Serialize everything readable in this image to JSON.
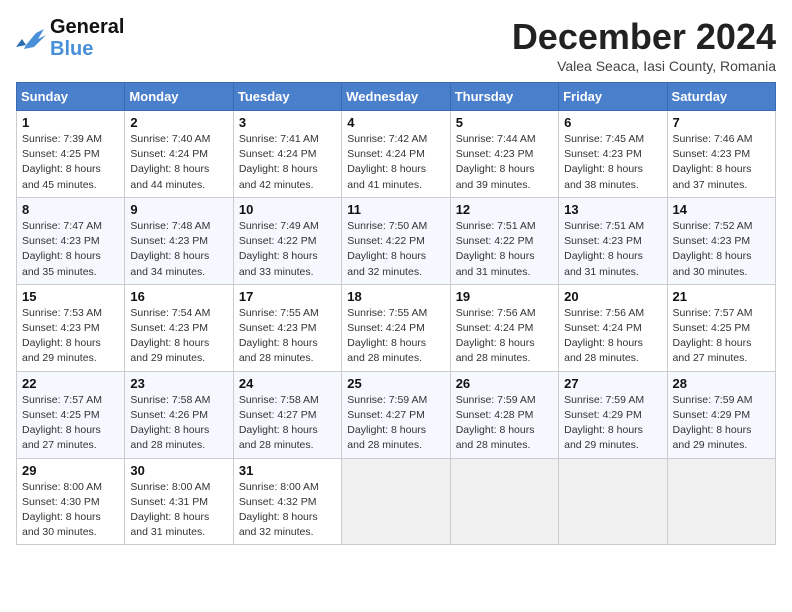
{
  "header": {
    "logo_line1": "General",
    "logo_line2": "Blue",
    "month_title": "December 2024",
    "location": "Valea Seaca, Iasi County, Romania"
  },
  "weekdays": [
    "Sunday",
    "Monday",
    "Tuesday",
    "Wednesday",
    "Thursday",
    "Friday",
    "Saturday"
  ],
  "weeks": [
    [
      {
        "day": "1",
        "sunrise": "Sunrise: 7:39 AM",
        "sunset": "Sunset: 4:25 PM",
        "daylight": "Daylight: 8 hours and 45 minutes."
      },
      {
        "day": "2",
        "sunrise": "Sunrise: 7:40 AM",
        "sunset": "Sunset: 4:24 PM",
        "daylight": "Daylight: 8 hours and 44 minutes."
      },
      {
        "day": "3",
        "sunrise": "Sunrise: 7:41 AM",
        "sunset": "Sunset: 4:24 PM",
        "daylight": "Daylight: 8 hours and 42 minutes."
      },
      {
        "day": "4",
        "sunrise": "Sunrise: 7:42 AM",
        "sunset": "Sunset: 4:24 PM",
        "daylight": "Daylight: 8 hours and 41 minutes."
      },
      {
        "day": "5",
        "sunrise": "Sunrise: 7:44 AM",
        "sunset": "Sunset: 4:23 PM",
        "daylight": "Daylight: 8 hours and 39 minutes."
      },
      {
        "day": "6",
        "sunrise": "Sunrise: 7:45 AM",
        "sunset": "Sunset: 4:23 PM",
        "daylight": "Daylight: 8 hours and 38 minutes."
      },
      {
        "day": "7",
        "sunrise": "Sunrise: 7:46 AM",
        "sunset": "Sunset: 4:23 PM",
        "daylight": "Daylight: 8 hours and 37 minutes."
      }
    ],
    [
      {
        "day": "8",
        "sunrise": "Sunrise: 7:47 AM",
        "sunset": "Sunset: 4:23 PM",
        "daylight": "Daylight: 8 hours and 35 minutes."
      },
      {
        "day": "9",
        "sunrise": "Sunrise: 7:48 AM",
        "sunset": "Sunset: 4:23 PM",
        "daylight": "Daylight: 8 hours and 34 minutes."
      },
      {
        "day": "10",
        "sunrise": "Sunrise: 7:49 AM",
        "sunset": "Sunset: 4:22 PM",
        "daylight": "Daylight: 8 hours and 33 minutes."
      },
      {
        "day": "11",
        "sunrise": "Sunrise: 7:50 AM",
        "sunset": "Sunset: 4:22 PM",
        "daylight": "Daylight: 8 hours and 32 minutes."
      },
      {
        "day": "12",
        "sunrise": "Sunrise: 7:51 AM",
        "sunset": "Sunset: 4:22 PM",
        "daylight": "Daylight: 8 hours and 31 minutes."
      },
      {
        "day": "13",
        "sunrise": "Sunrise: 7:51 AM",
        "sunset": "Sunset: 4:23 PM",
        "daylight": "Daylight: 8 hours and 31 minutes."
      },
      {
        "day": "14",
        "sunrise": "Sunrise: 7:52 AM",
        "sunset": "Sunset: 4:23 PM",
        "daylight": "Daylight: 8 hours and 30 minutes."
      }
    ],
    [
      {
        "day": "15",
        "sunrise": "Sunrise: 7:53 AM",
        "sunset": "Sunset: 4:23 PM",
        "daylight": "Daylight: 8 hours and 29 minutes."
      },
      {
        "day": "16",
        "sunrise": "Sunrise: 7:54 AM",
        "sunset": "Sunset: 4:23 PM",
        "daylight": "Daylight: 8 hours and 29 minutes."
      },
      {
        "day": "17",
        "sunrise": "Sunrise: 7:55 AM",
        "sunset": "Sunset: 4:23 PM",
        "daylight": "Daylight: 8 hours and 28 minutes."
      },
      {
        "day": "18",
        "sunrise": "Sunrise: 7:55 AM",
        "sunset": "Sunset: 4:24 PM",
        "daylight": "Daylight: 8 hours and 28 minutes."
      },
      {
        "day": "19",
        "sunrise": "Sunrise: 7:56 AM",
        "sunset": "Sunset: 4:24 PM",
        "daylight": "Daylight: 8 hours and 28 minutes."
      },
      {
        "day": "20",
        "sunrise": "Sunrise: 7:56 AM",
        "sunset": "Sunset: 4:24 PM",
        "daylight": "Daylight: 8 hours and 28 minutes."
      },
      {
        "day": "21",
        "sunrise": "Sunrise: 7:57 AM",
        "sunset": "Sunset: 4:25 PM",
        "daylight": "Daylight: 8 hours and 27 minutes."
      }
    ],
    [
      {
        "day": "22",
        "sunrise": "Sunrise: 7:57 AM",
        "sunset": "Sunset: 4:25 PM",
        "daylight": "Daylight: 8 hours and 27 minutes."
      },
      {
        "day": "23",
        "sunrise": "Sunrise: 7:58 AM",
        "sunset": "Sunset: 4:26 PM",
        "daylight": "Daylight: 8 hours and 28 minutes."
      },
      {
        "day": "24",
        "sunrise": "Sunrise: 7:58 AM",
        "sunset": "Sunset: 4:27 PM",
        "daylight": "Daylight: 8 hours and 28 minutes."
      },
      {
        "day": "25",
        "sunrise": "Sunrise: 7:59 AM",
        "sunset": "Sunset: 4:27 PM",
        "daylight": "Daylight: 8 hours and 28 minutes."
      },
      {
        "day": "26",
        "sunrise": "Sunrise: 7:59 AM",
        "sunset": "Sunset: 4:28 PM",
        "daylight": "Daylight: 8 hours and 28 minutes."
      },
      {
        "day": "27",
        "sunrise": "Sunrise: 7:59 AM",
        "sunset": "Sunset: 4:29 PM",
        "daylight": "Daylight: 8 hours and 29 minutes."
      },
      {
        "day": "28",
        "sunrise": "Sunrise: 7:59 AM",
        "sunset": "Sunset: 4:29 PM",
        "daylight": "Daylight: 8 hours and 29 minutes."
      }
    ],
    [
      {
        "day": "29",
        "sunrise": "Sunrise: 8:00 AM",
        "sunset": "Sunset: 4:30 PM",
        "daylight": "Daylight: 8 hours and 30 minutes."
      },
      {
        "day": "30",
        "sunrise": "Sunrise: 8:00 AM",
        "sunset": "Sunset: 4:31 PM",
        "daylight": "Daylight: 8 hours and 31 minutes."
      },
      {
        "day": "31",
        "sunrise": "Sunrise: 8:00 AM",
        "sunset": "Sunset: 4:32 PM",
        "daylight": "Daylight: 8 hours and 32 minutes."
      },
      null,
      null,
      null,
      null
    ]
  ]
}
